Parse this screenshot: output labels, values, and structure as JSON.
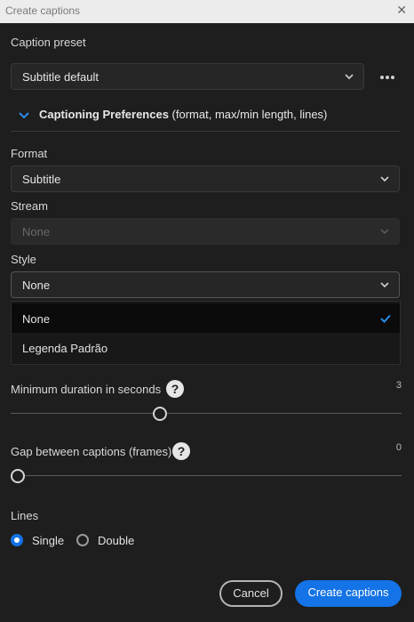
{
  "window": {
    "title": "Create captions",
    "close_icon": "close-icon"
  },
  "caption_preset": {
    "label": "Caption preset",
    "value": "Subtitle default",
    "more_icon": "more-options-icon"
  },
  "preferences": {
    "bold": "Captioning Preferences",
    "rest": " (format, max/min length, lines)"
  },
  "format": {
    "label": "Format",
    "value": "Subtitle"
  },
  "stream": {
    "label": "Stream",
    "value": "None"
  },
  "style": {
    "label": "Style",
    "value": "None",
    "options": [
      {
        "label": "None",
        "selected": true
      },
      {
        "label": "Legenda Padrão",
        "selected": false
      }
    ]
  },
  "min_duration": {
    "label": "Minimum duration in seconds",
    "value": "3"
  },
  "gap": {
    "label": "Gap between captions (frames)",
    "value": "0"
  },
  "lines": {
    "label": "Lines",
    "options": [
      "Single",
      "Double"
    ],
    "selected": "Single"
  },
  "buttons": {
    "cancel": "Cancel",
    "create": "Create captions"
  },
  "colors": {
    "accent": "#1473e6",
    "background": "#1e1e1e"
  }
}
